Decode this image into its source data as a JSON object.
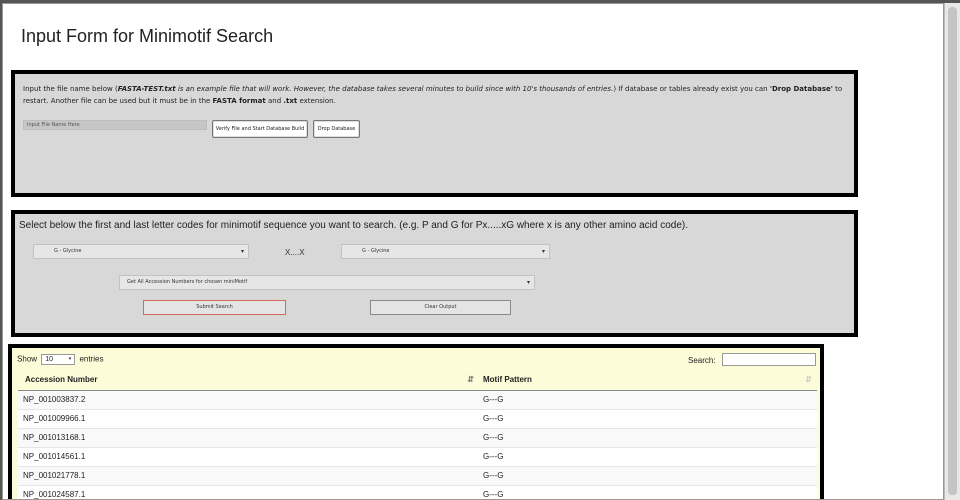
{
  "page": {
    "title": "Input Form for Minimotif Search"
  },
  "file_panel": {
    "instructions_html": "Input the file name below (<b><i>FASTA-TEST.txt</i></b> <i>is an example file that will work. However, the database takes several minutes to build since with 10's thousands of entries.</i>) If database or tables already exist you can <b>'Drop Database'</b> to restart. Another file can be used but it must be in the <b>FASTA format</b> and <b>.txt</b> extension.",
    "file_input_placeholder": "Input File Name Here",
    "verify_button": "Verify File and Start Database Build",
    "drop_button": "Drop Database"
  },
  "search_panel": {
    "instructions": "Select below the first and last letter codes for minimotif sequence you want to search. (e.g. P and G for Px.....xG where x is any other amino acid code).",
    "first_letter_selected": "G - Glycine",
    "separator": "X....X",
    "last_letter_selected": "G - Glycine",
    "mode_selected": "Get All Accession Numbers for chosen miniMotif",
    "submit_button": "Submit Search",
    "clear_button": "Clear Output"
  },
  "results": {
    "show_label": "Show",
    "length_selected": "10",
    "entries_label": "entries",
    "search_label": "Search:",
    "columns": [
      "Accession Number",
      "Motif Pattern"
    ],
    "rows": [
      [
        "NP_001003837.2",
        "G---G"
      ],
      [
        "NP_001009966.1",
        "G---G"
      ],
      [
        "NP_001013168.1",
        "G---G"
      ],
      [
        "NP_001014561.1",
        "G---G"
      ],
      [
        "NP_001021778.1",
        "G---G"
      ],
      [
        "NP_001024587.1",
        "G---G"
      ]
    ]
  },
  "colors": {
    "panel_bg": "#d8d8d8",
    "panel_border": "#000000",
    "table_panel_bg": "#fcfcd8",
    "submit_border": "#d46a5a"
  },
  "icons": {
    "caret": "▾",
    "sort_active": "⇵",
    "sort_inactive": "⇵"
  }
}
